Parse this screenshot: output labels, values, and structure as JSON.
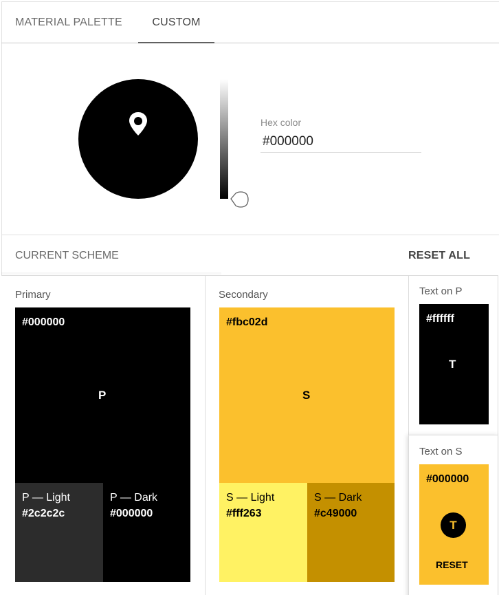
{
  "tabs": [
    {
      "label": "MATERIAL PALETTE"
    },
    {
      "label": "CUSTOM",
      "active": true
    }
  ],
  "picker": {
    "selected_color": "#000000",
    "hex_label": "Hex color",
    "hex_value": "#000000"
  },
  "scheme": {
    "title": "CURRENT SCHEME",
    "reset_all": "RESET ALL"
  },
  "primary": {
    "title": "Primary",
    "hex": "#000000",
    "letter": "P",
    "main_color": "#000000",
    "light": {
      "name": "P — Light",
      "hex": "#2c2c2c",
      "color": "#2c2c2c"
    },
    "dark": {
      "name": "P — Dark",
      "hex": "#000000",
      "color": "#000000"
    }
  },
  "secondary": {
    "title": "Secondary",
    "hex": "#fbc02d",
    "letter": "S",
    "main_color": "#fbc02d",
    "light": {
      "name": "S — Light",
      "hex": "#fff263",
      "color": "#fff263"
    },
    "dark": {
      "name": "S — Dark",
      "hex": "#c49000",
      "color": "#c49000"
    }
  },
  "text_on_p": {
    "title": "Text on P",
    "hex": "#ffffff",
    "letter": "T",
    "background": "#000000"
  },
  "text_on_s": {
    "title": "Text on S",
    "hex": "#000000",
    "letter": "T",
    "background": "#fbc02d",
    "reset": "RESET"
  },
  "icons": {
    "wheel_pin": "map-pin-icon",
    "slider_handle": "drop-handle-icon"
  }
}
